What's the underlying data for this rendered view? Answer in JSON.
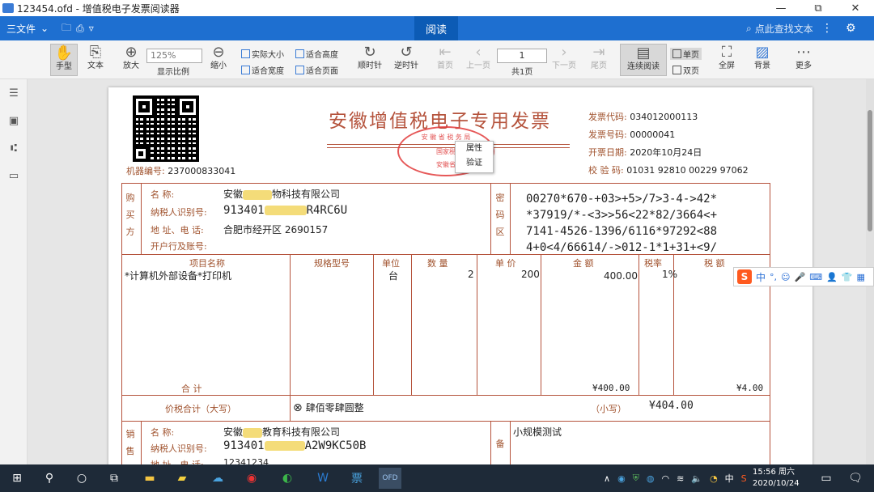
{
  "window": {
    "title": "123454.ofd - 增值税电子发票阅读器",
    "min": "—",
    "restore": "⧉",
    "close": "✕"
  },
  "menubar": {
    "file": "三文件",
    "active_tab": "阅读",
    "search_placeholder": "点此查找文本"
  },
  "toolbar": {
    "hand": "手型",
    "text": "文本",
    "zoom_in": "放大",
    "zoom_value": "125%",
    "fit_ratio": "显示比例",
    "zoom_out": "缩小",
    "actual_size": "实际大小",
    "fit_height": "适合高度",
    "fit_width": "适合宽度",
    "fit_page": "适合页面",
    "rotate_cw": "顺时针",
    "rotate_ccw": "逆时针",
    "first": "首页",
    "prev": "上一页",
    "page_value": "1",
    "total": "共1页",
    "next": "下一页",
    "last": "尾页",
    "continuous": "连续阅读",
    "single": "单页",
    "double": "双页",
    "fullscreen": "全屏",
    "background": "背景",
    "more": "更多"
  },
  "invoice": {
    "title": "安徽增值税电子专用发票",
    "seal_top": "安 徽 省 税 务 局",
    "seal_mid": "国家税",
    "seal_bot": "安徽省",
    "code_label": "发票代码:",
    "code": "034012000113",
    "number_label": "发票号码:",
    "number": "00000041",
    "date_label": "开票日期:",
    "date": "2020年10月24日",
    "check_label": "校 验 码:",
    "check": "01031 92810 00229 97062",
    "machine_label": "机器编号:",
    "machine": "237000833041",
    "buyer_label": [
      "购",
      "买",
      "方"
    ],
    "name_label": "名        称:",
    "buyer_name_a": "安徽",
    "buyer_name_b": "物科技有限公司",
    "taxid_label": "纳税人识别号:",
    "buyer_taxid_a": "913401",
    "buyer_taxid_b": "R4RC6U",
    "addr_label": "地 址、电 话:",
    "buyer_addr": "合肥市经开区    2690157",
    "bank_label": "开户行及账号:",
    "cipher_label": [
      "密",
      "码",
      "区"
    ],
    "cipher": [
      "00270*670-+03>+5>/7>3-4->42*",
      "*37919/*-<3>>56<22*82/3664<+",
      "7141-4526-1396/6116*97292<88",
      "4+0<4/66614/->012-1*1+31+<9/"
    ],
    "col_item": "项目名称",
    "col_spec": "规格型号",
    "col_unit": "单位",
    "col_qty": "数  量",
    "col_price": "单  价",
    "col_amount": "金    额",
    "col_rate": "税率",
    "col_tax": "税    额",
    "item": "*计算机外部设备*打印机",
    "unit": "台",
    "qty": "2",
    "price": "200",
    "amount": "400.00",
    "rate": "1%",
    "total_label": "合        计",
    "total_amount": "¥400.00",
    "total_tax": "¥4.00",
    "grand_label": "价税合计（大写）",
    "grand_cn": "肆佰零肆圆整",
    "grand_small_label": "（小写）",
    "grand_small": "¥404.00",
    "seller_label": [
      "销",
      "售"
    ],
    "seller_name_a": "安徽",
    "seller_name_b": "教育科技有限公司",
    "seller_taxid_a": "913401",
    "seller_taxid_b": "A2W9KC50B",
    "seller_addr": "12341234",
    "remark_label": "备",
    "remark": "小规模测试"
  },
  "context_menu": {
    "props": "属性",
    "verify": "验证"
  },
  "ime": {
    "logo": "S",
    "lang": "中"
  },
  "taskbar": {
    "time": "15:56 周六",
    "date": "2020/10/24",
    "ime": "中"
  }
}
